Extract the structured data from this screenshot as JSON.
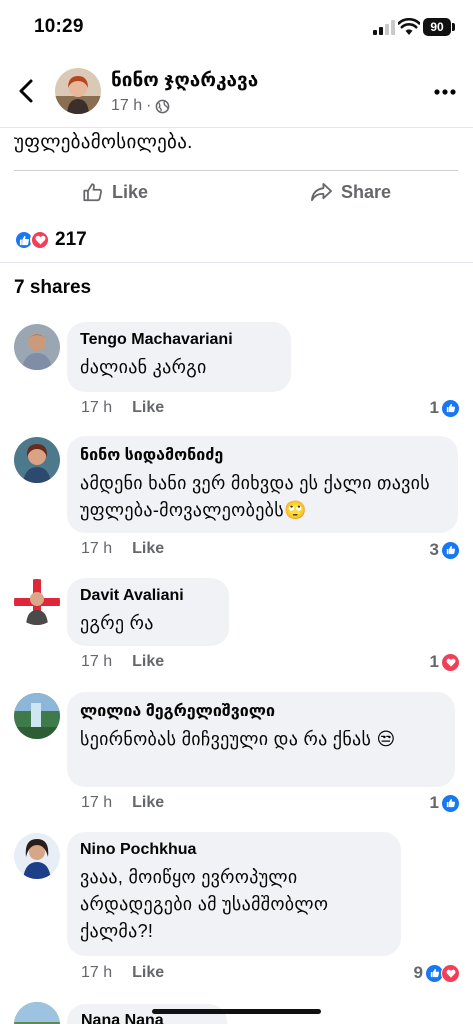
{
  "status_bar": {
    "time": "10:29",
    "battery": "90"
  },
  "header": {
    "author": "ნინო ჯღარკავა",
    "time": "17 h"
  },
  "post": {
    "text_tail": "უფლებამოსილება."
  },
  "actions": {
    "like_label": "Like",
    "share_label": "Share"
  },
  "reactions": {
    "count": "217"
  },
  "shares_label": "7 shares",
  "comments": [
    {
      "author": "Tengo Machavariani",
      "text": "ძალიან კარგი",
      "time": "17 h",
      "like_label": "Like",
      "reaction_count": "1"
    },
    {
      "author": "ნინო სიდამონიძე",
      "text": "ამდენი ხანი ვერ მიხვდა ეს ქალი თავის უფლება-მოვალეობებს🙄",
      "time": "17 h",
      "like_label": "Like",
      "reaction_count": "3"
    },
    {
      "author": "Davit Avaliani",
      "text": "ეგრე რა",
      "time": "17 h",
      "like_label": "Like",
      "reaction_count": "1"
    },
    {
      "author": "ლილია მეგრელიშვილი",
      "text": "სეირნობას მიჩვეული და რა ქნას 😒",
      "time": "17 h",
      "like_label": "Like",
      "reaction_count": "1"
    },
    {
      "author": "Nino Pochkhua",
      "text": "ვააა, მოიწყო ევროპული არდადეგები ამ უსამშობლო ქალმა?!",
      "time": "17 h",
      "like_label": "Like",
      "reaction_count": "9"
    },
    {
      "author": "Nana Nana"
    }
  ],
  "icons": {
    "back": "chevron-left-icon",
    "more": "more-dots-icon",
    "globe": "globe-icon",
    "like": "thumbs-up-icon",
    "share": "share-arrow-icon"
  },
  "colors": {
    "like_blue": "#1877f2",
    "love_red": "#f33e58",
    "meta_gray": "#65676b",
    "bubble": "#f0f2f5"
  }
}
